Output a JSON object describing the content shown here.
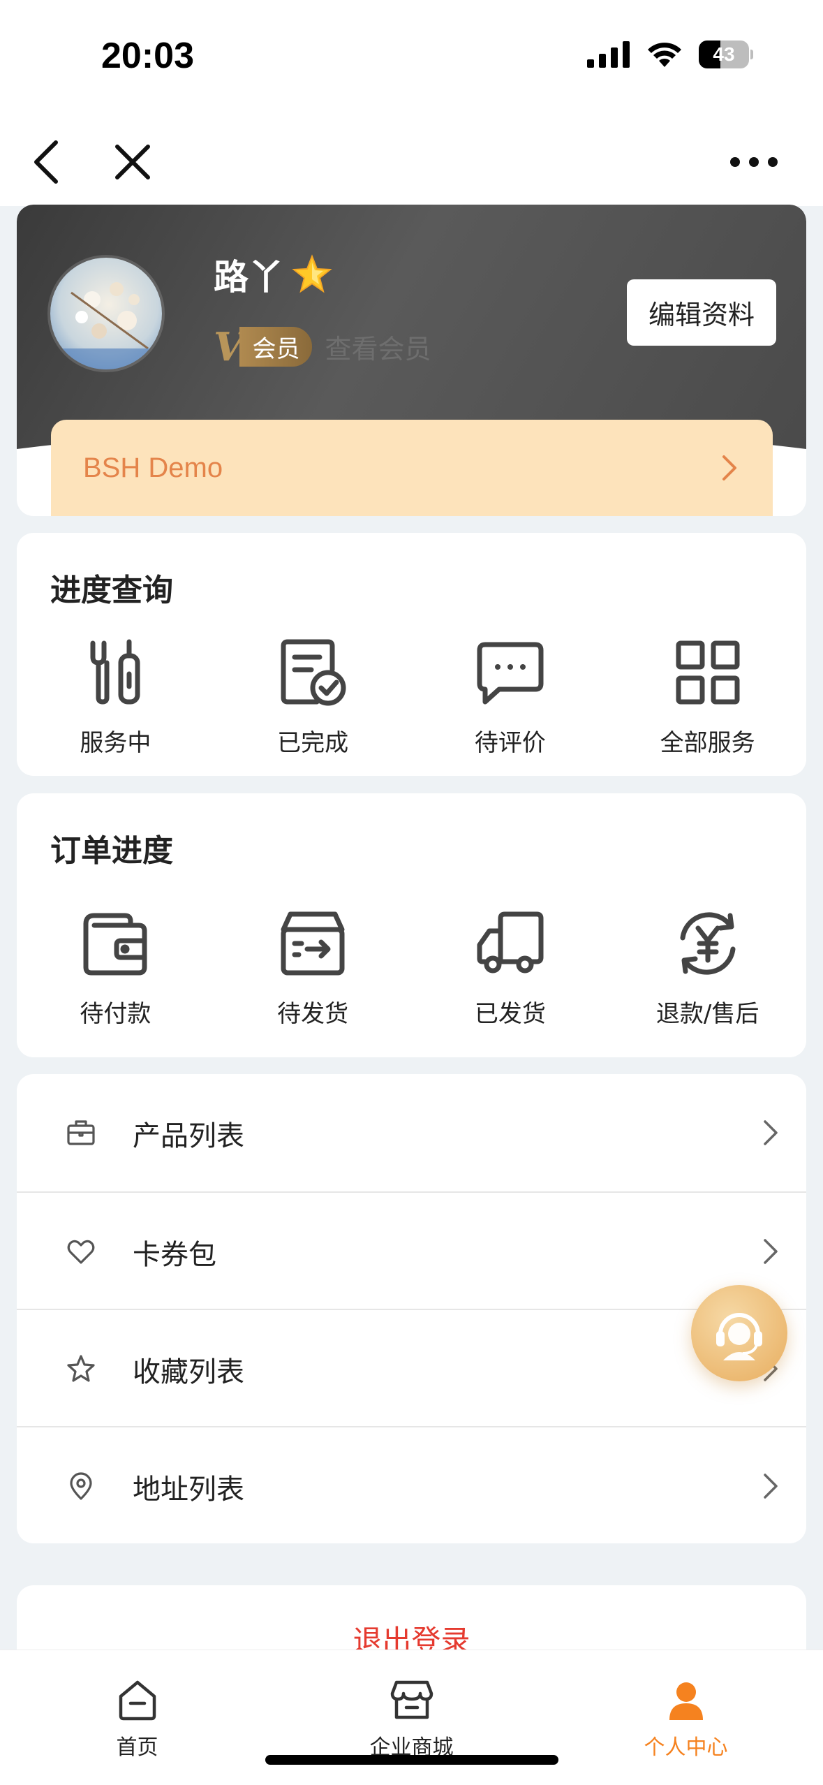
{
  "status_bar": {
    "time": "20:03",
    "battery": "43"
  },
  "profile": {
    "username": "路丫",
    "member_badge": "会员",
    "view_member": "查看会员",
    "edit_button": "编辑资料",
    "company": "BSH Demo"
  },
  "progress": {
    "title": "进度查询",
    "items": [
      {
        "label": "服务中",
        "icon": "wrench-screwdriver-icon"
      },
      {
        "label": "已完成",
        "icon": "document-check-icon"
      },
      {
        "label": "待评价",
        "icon": "chat-bubble-icon"
      },
      {
        "label": "全部服务",
        "icon": "grid-icon"
      }
    ]
  },
  "orders": {
    "title": "订单进度",
    "items": [
      {
        "label": "待付款",
        "icon": "wallet-icon"
      },
      {
        "label": "待发货",
        "icon": "box-arrow-icon"
      },
      {
        "label": "已发货",
        "icon": "truck-icon"
      },
      {
        "label": "退款/售后",
        "icon": "yen-refresh-icon"
      }
    ]
  },
  "menu": [
    {
      "label": "产品列表",
      "icon": "briefcase-icon"
    },
    {
      "label": "卡券包",
      "icon": "heart-icon"
    },
    {
      "label": "收藏列表",
      "icon": "star-icon"
    },
    {
      "label": "地址列表",
      "icon": "location-pin-icon"
    }
  ],
  "logout": "退出登录",
  "tabbar": [
    {
      "label": "首页",
      "icon": "home-icon"
    },
    {
      "label": "企业商城",
      "icon": "store-icon"
    },
    {
      "label": "个人中心",
      "icon": "person-icon",
      "active": true
    }
  ],
  "colors": {
    "accent": "#f5821f",
    "company_bg": "#fde3bb",
    "company_text": "#e4844a",
    "logout": "#e53a2f"
  }
}
